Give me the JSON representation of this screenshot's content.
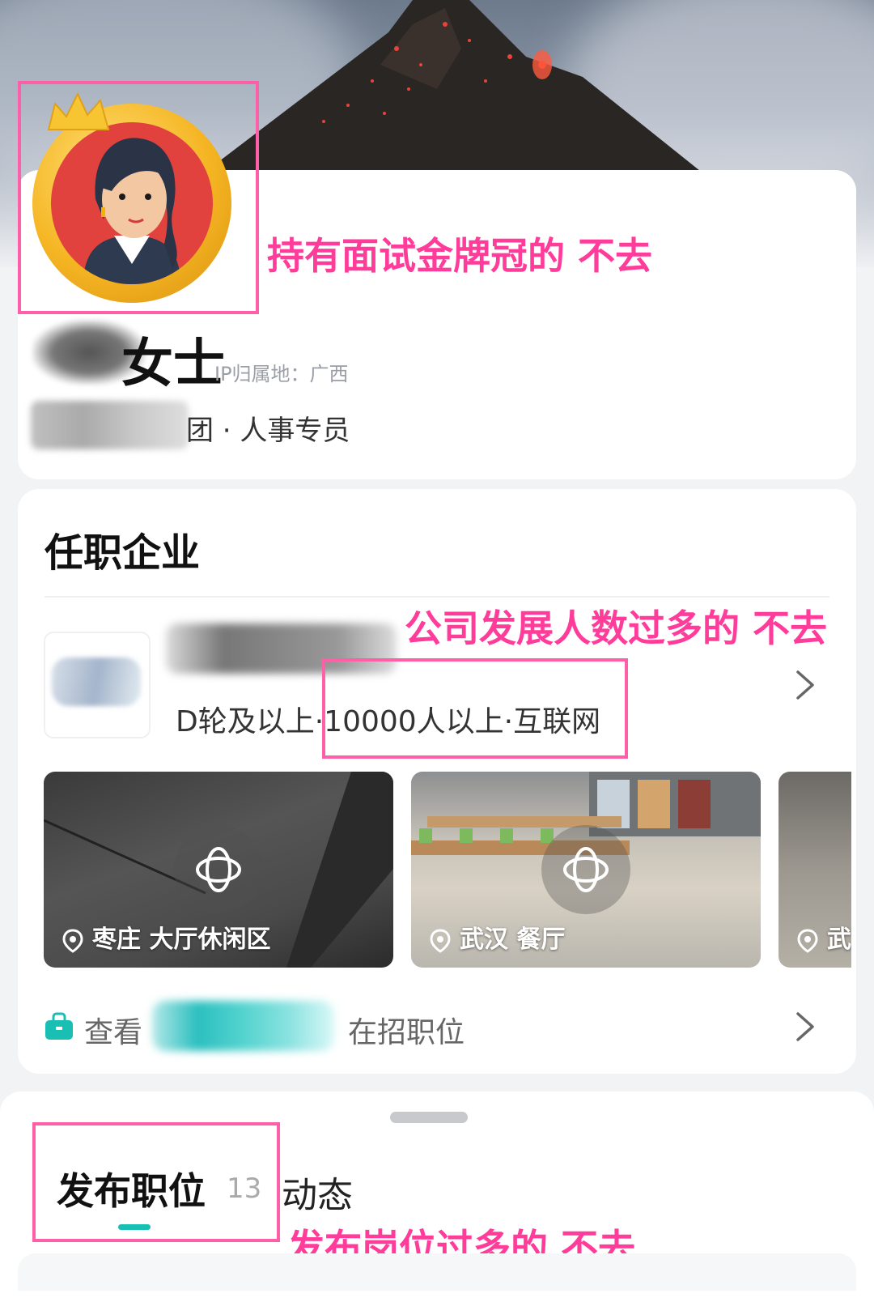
{
  "profile": {
    "name_visible": "女士",
    "ip_location": "IP归属地：广西",
    "job_title": "团 · 人事专员"
  },
  "company_section": {
    "title": "任职企业",
    "meta": "D轮及以上·10000人以上·互联网",
    "photos": [
      {
        "location": "枣庄",
        "place": "大厅休闲区"
      },
      {
        "location": "武汉",
        "place": "餐厅"
      },
      {
        "location": "武",
        "place": ""
      }
    ],
    "view_prefix": "查看",
    "view_suffix": "在招职位"
  },
  "tabs": {
    "posted_label": "发布职位",
    "posted_count": "13",
    "activity_label": "动态"
  },
  "annotations": {
    "crown_note": "持有面试金牌冠的 不去",
    "company_note": "公司发展人数过多的 不去",
    "jobs_note": "发布岗位过多的 不去"
  },
  "colors": {
    "accent": "#1abfb4",
    "annotation": "#ff3c9a",
    "highlight_box": "#ff5fa8"
  },
  "icons": [
    "crown-icon",
    "location-pin-icon",
    "vr-360-icon",
    "chevron-right-icon",
    "briefcase-icon"
  ]
}
